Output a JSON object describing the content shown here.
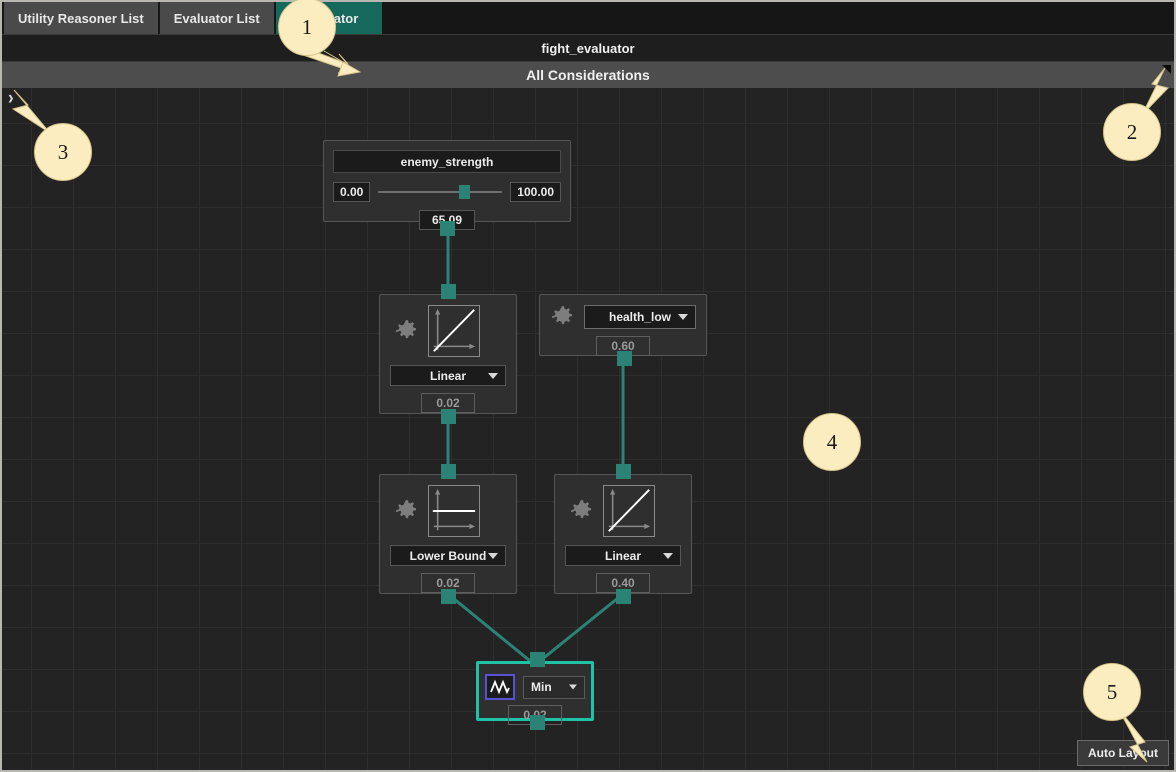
{
  "window": {
    "title": "fight_evaluator",
    "subtitle": "All Considerations"
  },
  "tabs": [
    {
      "label": "Utility Reasoner List",
      "active": false
    },
    {
      "label": "Evaluator List",
      "active": false
    },
    {
      "label": "Evaluator",
      "active": true
    }
  ],
  "canvas": {
    "collapse_chevron": "›",
    "auto_layout_label": "Auto Layout"
  },
  "nodes": {
    "enemy_strength": {
      "title": "enemy_strength",
      "min": "0.00",
      "max": "100.00",
      "value": "65.09",
      "slider_percent": 65
    },
    "linear_top": {
      "curve": "Linear",
      "value": "0.02",
      "icon": "gear-icon",
      "graph": "linear-curve-icon"
    },
    "health_low": {
      "input": "health_low",
      "value": "0.60",
      "icon": "gear-icon"
    },
    "lower_bound": {
      "curve": "Lower Bound",
      "value": "0.02",
      "icon": "gear-icon",
      "graph": "lower-bound-curve-icon"
    },
    "linear_bottom": {
      "curve": "Linear",
      "value": "0.40",
      "icon": "gear-icon",
      "graph": "linear-curve-icon"
    },
    "min_node": {
      "operator": "Min",
      "value": "0.02",
      "icon": "wave-icon",
      "selected": true
    }
  },
  "annotations": [
    {
      "id": "1",
      "label": "1"
    },
    {
      "id": "2",
      "label": "2"
    },
    {
      "id": "3",
      "label": "3"
    },
    {
      "id": "4",
      "label": "4"
    },
    {
      "id": "5",
      "label": "5"
    }
  ],
  "colors": {
    "accent_teal": "#15695c",
    "port_teal": "#2a8375",
    "selection_teal": "#1fc2a7",
    "icon_purple": "#5b4fd6",
    "canvas_bg": "#232323",
    "annotation_bg": "#fbedbf"
  }
}
